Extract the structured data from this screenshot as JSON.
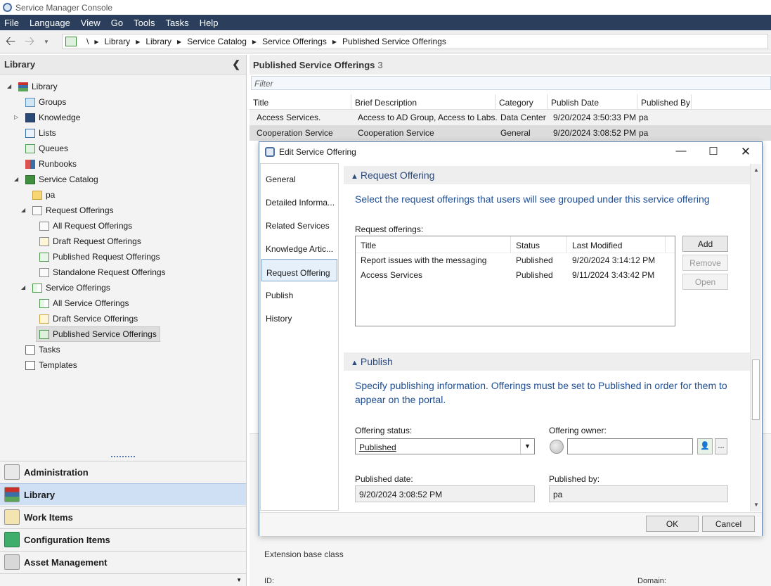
{
  "window": {
    "title": "Service Manager Console"
  },
  "menu": [
    "File",
    "Language",
    "View",
    "Go",
    "Tools",
    "Tasks",
    "Help"
  ],
  "breadcrumb": [
    "\\",
    "Library",
    "Library",
    "Service Catalog",
    "Service Offerings",
    "Published Service Offerings"
  ],
  "left_pane": {
    "title": "Library",
    "tree": [
      {
        "label": "Library"
      },
      {
        "label": "Groups"
      },
      {
        "label": "Knowledge"
      },
      {
        "label": "Lists"
      },
      {
        "label": "Queues"
      },
      {
        "label": "Runbooks"
      },
      {
        "label": "Service Catalog"
      },
      {
        "label": "pa"
      },
      {
        "label": "Request Offerings"
      },
      {
        "label": "All Request Offerings"
      },
      {
        "label": "Draft Request Offerings"
      },
      {
        "label": "Published Request Offerings"
      },
      {
        "label": "Standalone Request Offerings"
      },
      {
        "label": "Service Offerings"
      },
      {
        "label": "All Service Offerings"
      },
      {
        "label": "Draft Service Offerings"
      },
      {
        "label": "Published Service Offerings"
      },
      {
        "label": "Tasks"
      },
      {
        "label": "Templates"
      }
    ],
    "workspaces": [
      "Administration",
      "Library",
      "Work Items",
      "Configuration Items",
      "Asset Management"
    ]
  },
  "right_pane": {
    "title": "Published Service Offerings",
    "count": "3",
    "filter_placeholder": "Filter",
    "columns": [
      "Title",
      "Brief Description",
      "Category",
      "Publish Date",
      "Published By"
    ],
    "rows": [
      [
        "Access Services.",
        "Access to AD Group, Access to Labs.",
        "Data Center",
        "9/20/2024 3:50:33 PM",
        "pa"
      ],
      [
        "Cooperation Service",
        "Cooperation Service",
        "General",
        "9/20/2024 3:08:52 PM",
        "pa"
      ]
    ],
    "extension_label": "Extension base class",
    "id_label": "ID:",
    "domain_label": "Domain:"
  },
  "dialog": {
    "title": "Edit Service Offering",
    "nav": [
      "General",
      "Detailed Informa...",
      "Related Services",
      "Knowledge Artic...",
      "Request Offering",
      "Publish",
      "History"
    ],
    "request_offering": {
      "heading": "Request Offering",
      "description": "Select the request offerings that users will see grouped under this service offering",
      "list_label": "Request offerings:",
      "columns": [
        "Title",
        "Status",
        "Last Modified"
      ],
      "rows": [
        [
          "Report issues with the messaging",
          "Published",
          "9/20/2024 3:14:12 PM"
        ],
        [
          "Access Services",
          "Published",
          "9/11/2024 3:43:42 PM"
        ]
      ],
      "buttons": {
        "add": "Add",
        "remove": "Remove",
        "open": "Open"
      }
    },
    "publish": {
      "heading": "Publish",
      "description": "Specify publishing information.  Offerings must be set to Published in order for them to appear on the portal.",
      "status_label": "Offering status:",
      "status_value": "Published",
      "owner_label": "Offering owner:",
      "owner_value": "",
      "owner_more": "...",
      "published_date_label": "Published date:",
      "published_date_value": "9/20/2024 3:08:52 PM",
      "published_by_label": "Published by:",
      "published_by_value": "pa"
    },
    "ok": "OK",
    "cancel": "Cancel"
  }
}
